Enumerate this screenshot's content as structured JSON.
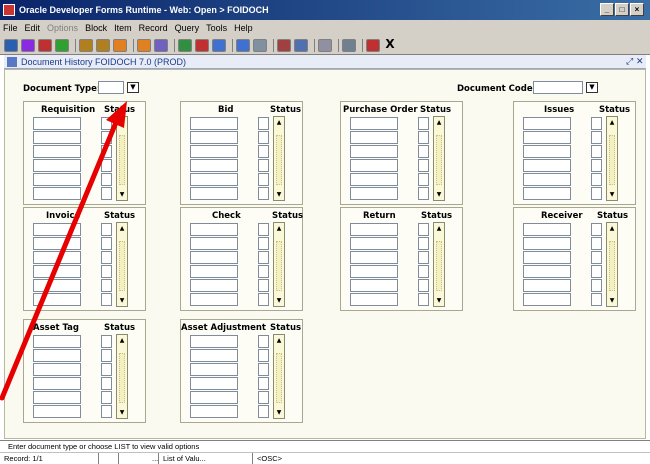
{
  "window": {
    "title": "Oracle Developer Forms Runtime - Web: Open > FOIDOCH"
  },
  "menu": [
    {
      "label": "File",
      "disabled": false
    },
    {
      "label": "Edit",
      "disabled": false
    },
    {
      "label": "Options",
      "disabled": true
    },
    {
      "label": "Block",
      "disabled": false
    },
    {
      "label": "Item",
      "disabled": false
    },
    {
      "label": "Record",
      "disabled": false
    },
    {
      "label": "Query",
      "disabled": false
    },
    {
      "label": "Tools",
      "disabled": false
    },
    {
      "label": "Help",
      "disabled": false
    }
  ],
  "toolbar": {
    "icons": [
      "save-icon",
      "print-icon",
      "close-form-icon",
      "rollback-icon",
      "prev-block-icon",
      "next-block-icon",
      "prev-record-icon",
      "next-record-icon",
      "enter-query-icon",
      "execute-query-icon",
      "cancel-query-icon",
      "insert-record-icon",
      "remove-record-icon",
      "print-screen-icon",
      "calendar-icon",
      "list-values-icon",
      "edit-field-icon",
      "help-icon",
      "exit-icon"
    ],
    "exit_label": "X"
  },
  "form_window": {
    "title": "Document History  FOIDOCH  7.0  (PROD)",
    "close_glyph": "✕"
  },
  "header": {
    "document_type_label": "Document Type:",
    "document_type_value": "",
    "document_code_label": "Document Code:",
    "document_code_value": "",
    "dropdown_glyph": "▼"
  },
  "groups": [
    {
      "title": "Requisition",
      "status": "Status"
    },
    {
      "title": "Bid",
      "status": "Status"
    },
    {
      "title": "Purchase Order",
      "status": "Status"
    },
    {
      "title": "Issues",
      "status": "Status"
    },
    {
      "title": "Invoice",
      "status": "Status"
    },
    {
      "title": "Check",
      "status": "Status"
    },
    {
      "title": "Return",
      "status": "Status"
    },
    {
      "title": "Receiver",
      "status": "Status"
    },
    {
      "title": "Asset Tag",
      "status": "Status"
    },
    {
      "title": "Asset Adjustment",
      "status": "Status"
    }
  ],
  "statusbar": {
    "message": "Enter document type or choose LIST to view valid options",
    "record": "Record: 1/1",
    "ellipsis": "...",
    "list_of_values": "List of Valu...",
    "osc": "<OSC>"
  },
  "colors": {
    "annotation_arrow": "#e60000",
    "title_gradient_start": "#0a246a"
  }
}
